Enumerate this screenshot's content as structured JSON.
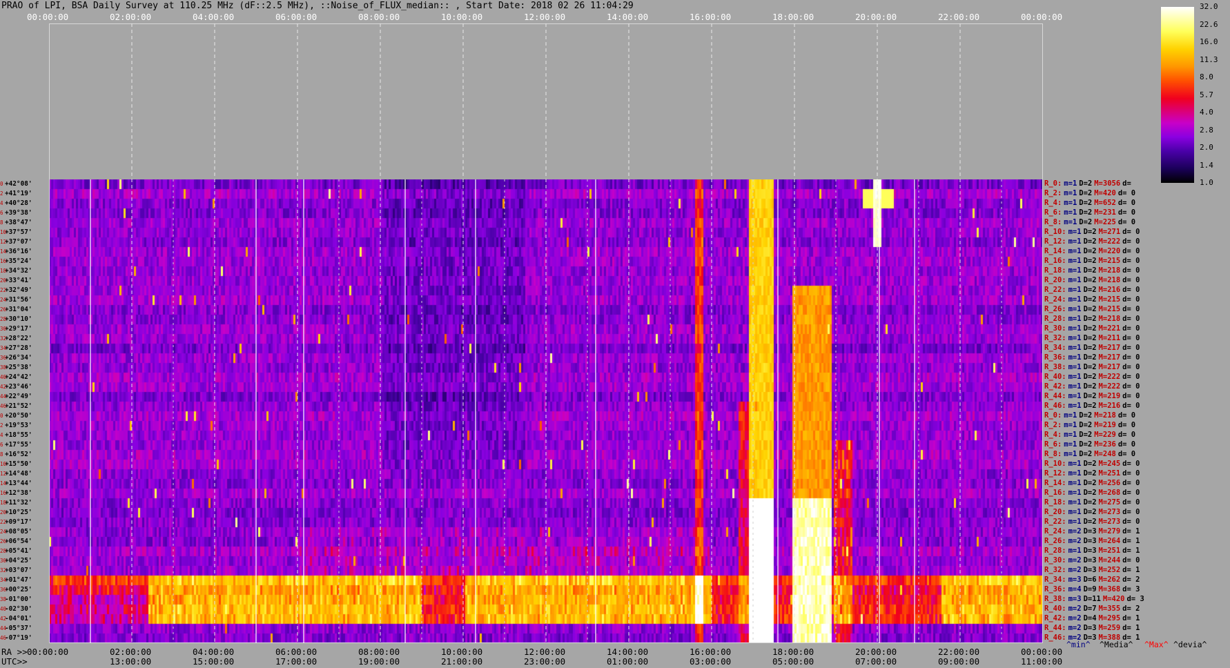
{
  "title": "PRAO of LPI, BSA Daily Survey at 110.25 MHz (dF::2.5 MHz), ::Noise_of_FLUX_median:: , Start Date: 2018 02 26 11:04:29",
  "top_axis_ticks": [
    "00:00:00",
    "02:00:00",
    "04:00:00",
    "06:00:00",
    "08:00:00",
    "10:00:00",
    "12:00:00",
    "14:00:00",
    "16:00:00",
    "18:00:00",
    "20:00:00",
    "22:00:00",
    "00:00:00"
  ],
  "ra_axis": {
    "label": "RA >>",
    "ticks": [
      "00:00:00",
      "02:00:00",
      "04:00:00",
      "06:00:00",
      "08:00:00",
      "10:00:00",
      "12:00:00",
      "14:00:00",
      "16:00:00",
      "18:00:00",
      "20:00:00",
      "22:00:00",
      "00:00:00"
    ]
  },
  "utc_axis": {
    "label": "UTC>>",
    "ticks": [
      "13:00:00",
      "15:00:00",
      "17:00:00",
      "19:00:00",
      "21:00:00",
      "23:00:00",
      "01:00:00",
      "03:00:00",
      "05:00:00",
      "07:00:00",
      "09:00:00",
      "11:00:00"
    ]
  },
  "declination_labels": [
    "+42°08'",
    "+41°19'",
    "+40°28'",
    "+39°38'",
    "+38°47'",
    "+37°57'",
    "+37°07'",
    "+36°16'",
    "+35°24'",
    "+34°32'",
    "+33°41'",
    "+32°49'",
    "+31°56'",
    "+31°04'",
    "+30°10'",
    "+29°17'",
    "+28°22'",
    "+27°28'",
    "+26°34'",
    "+25°38'",
    "+24°42'",
    "+23°46'",
    "+22°49'",
    "+21°52'",
    "+20°50'",
    "+19°53'",
    "+18°55'",
    "+17°55'",
    "+16°52'",
    "+15°50'",
    "+14°48'",
    "+13°44'",
    "+12°38'",
    "+11°32'",
    "+10°25'",
    "+09°17'",
    "+08°05'",
    "+06°54'",
    "+05°41'",
    "+04°25'",
    "+03°07'",
    "+01°47'",
    "+00°25'",
    "-01°00'",
    "-02°30'",
    "-04°01'",
    "-05°37'",
    "-07°19'"
  ],
  "beam_index_labels": [
    "0",
    "2",
    "4",
    "6",
    "8",
    "10",
    "12",
    "14",
    "16",
    "18",
    "20",
    "22",
    "24",
    "26",
    "28",
    "30",
    "32",
    "34",
    "36",
    "38",
    "40",
    "42",
    "44",
    "46",
    "0",
    "2",
    "4",
    "6",
    "8",
    "10",
    "12",
    "14",
    "16",
    "18",
    "20",
    "22",
    "24",
    "26",
    "28",
    "30",
    "32",
    "34",
    "36",
    "38",
    "40",
    "42",
    "44",
    "46"
  ],
  "right_stats": [
    {
      "label": "R_0:",
      "m": "m=1",
      "D": "D=2",
      "M": "M=3056",
      "d": "d="
    },
    {
      "label": "R_2:",
      "m": "m=1",
      "D": "D=2",
      "M": "M=420",
      "d": "d= 0"
    },
    {
      "label": "R_4:",
      "m": "m=1",
      "D": "D=2",
      "M": "M=652",
      "d": "d= 0"
    },
    {
      "label": "R_6:",
      "m": "m=1",
      "D": "D=2",
      "M": "M=231",
      "d": "d= 0"
    },
    {
      "label": "R_8:",
      "m": "m=1",
      "D": "D=2",
      "M": "M=225",
      "d": "d= 0"
    },
    {
      "label": "R_10:",
      "m": "m=1",
      "D": "D=2",
      "M": "M=271",
      "d": "d= 0"
    },
    {
      "label": "R_12:",
      "m": "m=1",
      "D": "D=2",
      "M": "M=222",
      "d": "d= 0"
    },
    {
      "label": "R_14:",
      "m": "m=1",
      "D": "D=2",
      "M": "M=220",
      "d": "d= 0"
    },
    {
      "label": "R_16:",
      "m": "m=1",
      "D": "D=2",
      "M": "M=215",
      "d": "d= 0"
    },
    {
      "label": "R_18:",
      "m": "m=1",
      "D": "D=2",
      "M": "M=218",
      "d": "d= 0"
    },
    {
      "label": "R_20:",
      "m": "m=1",
      "D": "D=2",
      "M": "M=218",
      "d": "d= 0"
    },
    {
      "label": "R_22:",
      "m": "m=1",
      "D": "D=2",
      "M": "M=216",
      "d": "d= 0"
    },
    {
      "label": "R_24:",
      "m": "m=1",
      "D": "D=2",
      "M": "M=215",
      "d": "d= 0"
    },
    {
      "label": "R_26:",
      "m": "m=1",
      "D": "D=2",
      "M": "M=215",
      "d": "d= 0"
    },
    {
      "label": "R_28:",
      "m": "m=1",
      "D": "D=2",
      "M": "M=218",
      "d": "d= 0"
    },
    {
      "label": "R_30:",
      "m": "m=1",
      "D": "D=2",
      "M": "M=221",
      "d": "d= 0"
    },
    {
      "label": "R_32:",
      "m": "m=1",
      "D": "D=2",
      "M": "M=211",
      "d": "d= 0"
    },
    {
      "label": "R_34:",
      "m": "m=1",
      "D": "D=2",
      "M": "M=217",
      "d": "d= 0"
    },
    {
      "label": "R_36:",
      "m": "m=1",
      "D": "D=2",
      "M": "M=217",
      "d": "d= 0"
    },
    {
      "label": "R_38:",
      "m": "m=1",
      "D": "D=2",
      "M": "M=217",
      "d": "d= 0"
    },
    {
      "label": "R_40:",
      "m": "m=1",
      "D": "D=2",
      "M": "M=222",
      "d": "d= 0"
    },
    {
      "label": "R_42:",
      "m": "m=1",
      "D": "D=2",
      "M": "M=222",
      "d": "d= 0"
    },
    {
      "label": "R_44:",
      "m": "m=1",
      "D": "D=2",
      "M": "M=219",
      "d": "d= 0"
    },
    {
      "label": "R_46:",
      "m": "m=1",
      "D": "D=2",
      "M": "M=216",
      "d": "d= 0"
    },
    {
      "label": "R_0:",
      "m": "m=1",
      "D": "D=2",
      "M": "M=218",
      "d": "d= 0"
    },
    {
      "label": "R_2:",
      "m": "m=1",
      "D": "D=2",
      "M": "M=219",
      "d": "d= 0"
    },
    {
      "label": "R_4:",
      "m": "m=1",
      "D": "D=2",
      "M": "M=229",
      "d": "d= 0"
    },
    {
      "label": "R_6:",
      "m": "m=1",
      "D": "D=2",
      "M": "M=236",
      "d": "d= 0"
    },
    {
      "label": "R_8:",
      "m": "m=1",
      "D": "D=2",
      "M": "M=248",
      "d": "d= 0"
    },
    {
      "label": "R_10:",
      "m": "m=1",
      "D": "D=2",
      "M": "M=245",
      "d": "d= 0"
    },
    {
      "label": "R_12:",
      "m": "m=1",
      "D": "D=2",
      "M": "M=251",
      "d": "d= 0"
    },
    {
      "label": "R_14:",
      "m": "m=1",
      "D": "D=2",
      "M": "M=256",
      "d": "d= 0"
    },
    {
      "label": "R_16:",
      "m": "m=1",
      "D": "D=2",
      "M": "M=268",
      "d": "d= 0"
    },
    {
      "label": "R_18:",
      "m": "m=1",
      "D": "D=2",
      "M": "M=275",
      "d": "d= 0"
    },
    {
      "label": "R_20:",
      "m": "m=1",
      "D": "D=2",
      "M": "M=273",
      "d": "d= 0"
    },
    {
      "label": "R_22:",
      "m": "m=1",
      "D": "D=2",
      "M": "M=273",
      "d": "d= 0"
    },
    {
      "label": "R_24:",
      "m": "m=2",
      "D": "D=3",
      "M": "M=279",
      "d": "d= 1"
    },
    {
      "label": "R_26:",
      "m": "m=2",
      "D": "D=3",
      "M": "M=264",
      "d": "d= 1"
    },
    {
      "label": "R_28:",
      "m": "m=1",
      "D": "D=3",
      "M": "M=251",
      "d": "d= 1"
    },
    {
      "label": "R_30:",
      "m": "m=2",
      "D": "D=3",
      "M": "M=244",
      "d": "d= 0"
    },
    {
      "label": "R_32:",
      "m": "m=2",
      "D": "D=3",
      "M": "M=252",
      "d": "d= 1"
    },
    {
      "label": "R_34:",
      "m": "m=3",
      "D": "D=6",
      "M": "M=262",
      "d": "d= 2"
    },
    {
      "label": "R_36:",
      "m": "m=4",
      "D": "D=9",
      "M": "M=368",
      "d": "d= 3"
    },
    {
      "label": "R_38:",
      "m": "m=3",
      "D": "D=11",
      "M": "M=420",
      "d": "d= 3"
    },
    {
      "label": "R_40:",
      "m": "m=2",
      "D": "D=7",
      "M": "M=355",
      "d": "d= 2"
    },
    {
      "label": "R_42:",
      "m": "m=2",
      "D": "D=4",
      "M": "M=295",
      "d": "d= 1"
    },
    {
      "label": "R_44:",
      "m": "m=2",
      "D": "D=3",
      "M": "M=259",
      "d": "d= 1"
    },
    {
      "label": "R_46:",
      "m": "m=2",
      "D": "D=3",
      "M": "M=388",
      "d": "d= 1"
    }
  ],
  "legend": {
    "min": "^min^",
    "media": "^Media^",
    "max": "^Max^",
    "devia": "^devia^"
  },
  "colorbar": {
    "ticks": [
      "32.0",
      "22.6",
      "16.0",
      "11.3",
      "8.0",
      "5.7",
      "4.0",
      "2.8",
      "2.0",
      "1.4",
      "1.0"
    ],
    "scale": "log",
    "colors": [
      "#000000",
      "#1a0058",
      "#4a00a8",
      "#8a00e0",
      "#c800c8",
      "#f0001e",
      "#ff5000",
      "#ff9600",
      "#ffd200",
      "#ffff5a",
      "#ffffff"
    ]
  },
  "chart_data": {
    "type": "heatmap",
    "title": "PRAO of LPI, BSA Daily Survey at 110.25 MHz (dF::2.5 MHz), ::Noise_of_FLUX_median:: , Start Date: 2018 02 26 11:04:29",
    "x_axis_top": "RA 00:00:00 - 24:00:00",
    "x_axis_bottom_utc": "13:00:00 - 11:00:00",
    "y_axis": "Declination +42°08' to -07°19' (48 beams)",
    "value_range": [
      1.0,
      32.0
    ],
    "color_scale": "log",
    "features": [
      {
        "ra_hours": [
          16.9,
          17.5
        ],
        "rows": [
          0,
          47
        ],
        "level": "high"
      },
      {
        "ra_hours": [
          17.9,
          18.9
        ],
        "rows": [
          18,
          47
        ],
        "level": "high"
      },
      {
        "ra_hours": [
          19.9,
          20.0
        ],
        "rows": [
          0,
          7
        ],
        "level": "peak"
      },
      {
        "ra_hours": [
          0,
          24
        ],
        "rows": [
          41,
          45
        ],
        "level": "elevated"
      }
    ]
  }
}
